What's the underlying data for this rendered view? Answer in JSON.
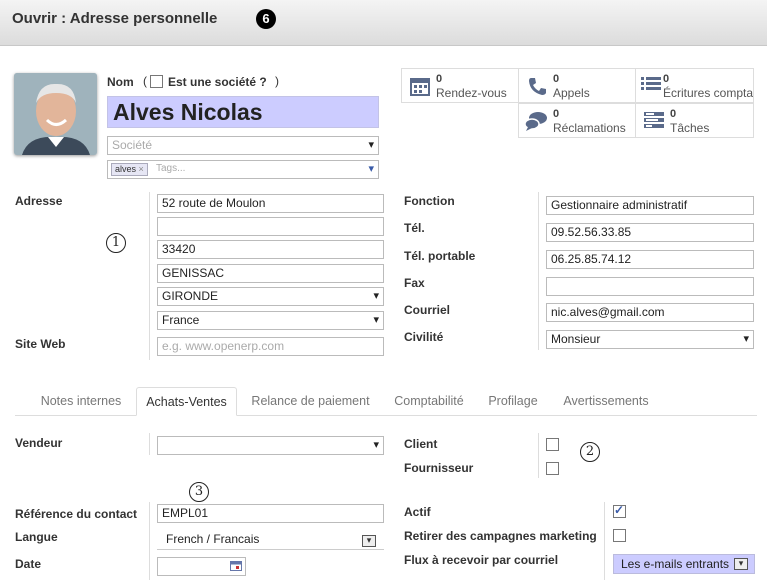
{
  "header": {
    "title": "Ouvrir : Adresse personnelle",
    "marker": "❻"
  },
  "partner": {
    "name_label": "Nom",
    "company_check_label": "Est une société ?",
    "paren_open": "(",
    "paren_close": ")",
    "name": "Alves Nicolas",
    "company_placeholder": "Société",
    "tag": "alves",
    "tag_remove": "×",
    "tags_placeholder": "Tags..."
  },
  "stats": [
    {
      "count": "0",
      "label": "Rendez-vous",
      "icon": "calendar-icon"
    },
    {
      "count": "0",
      "label": "Appels",
      "icon": "phone-icon"
    },
    {
      "count": "0",
      "label": "Écritures comptables",
      "icon": "list-icon"
    },
    {
      "count": "0",
      "label": "Réclamations",
      "icon": "chat-icon"
    },
    {
      "count": "0",
      "label": "Tâches",
      "icon": "tasks-icon"
    }
  ],
  "address": {
    "label": "Adresse",
    "street": "52 route de Moulon",
    "street2": "",
    "zip": "33420",
    "city": "GENISSAC",
    "state": "GIRONDE",
    "country": "France",
    "website_label": "Site Web",
    "website_placeholder": "e.g. www.openerp.com"
  },
  "contact": {
    "function_label": "Fonction",
    "function": "Gestionnaire administratif",
    "phone_label": "Tél.",
    "phone": "09.52.56.33.85",
    "mobile_label": "Tél. portable",
    "mobile": "06.25.85.74.12",
    "fax_label": "Fax",
    "fax": "",
    "email_label": "Courriel",
    "email": "nic.alves@gmail.com",
    "title_label": "Civilité",
    "title": "Monsieur"
  },
  "markers": {
    "m1": "1",
    "m2": "2",
    "m3": "3"
  },
  "tabs": [
    "Notes internes",
    "Achats-Ventes",
    "Relance de paiement",
    "Comptabilité",
    "Profilage",
    "Avertissements"
  ],
  "sales": {
    "salesman_label": "Vendeur",
    "salesman": "",
    "customer_label": "Client",
    "customer": false,
    "supplier_label": "Fournisseur",
    "supplier": false,
    "ref_label": "Référence du contact",
    "ref": "EMPL01",
    "lang_label": "Langue",
    "lang": "French / Francais",
    "date_label": "Date",
    "date": "",
    "active_label": "Actif",
    "active": true,
    "optout_label": "Retirer des campagnes marketing",
    "optout": false,
    "notify_label": "Flux à recevoir par courriel",
    "notify": "Les e-mails entrants"
  }
}
